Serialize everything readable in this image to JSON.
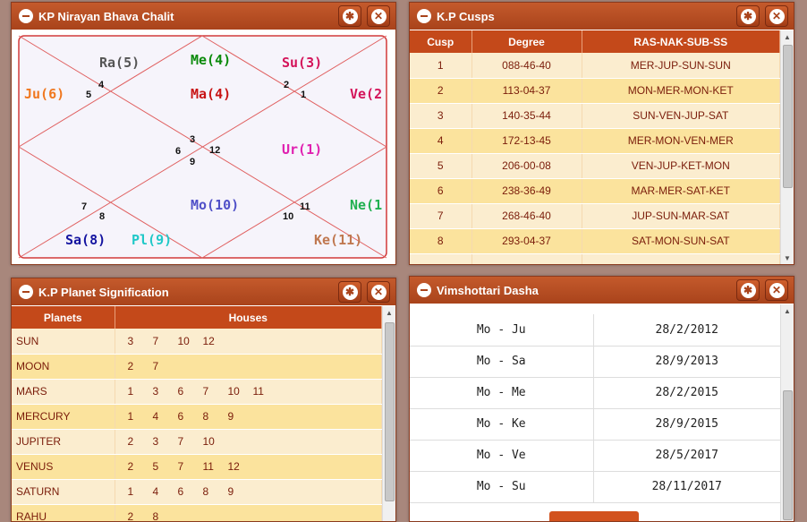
{
  "chalit": {
    "title": "KP Nirayan Bhava Chalit",
    "planets": [
      {
        "label": "Ra(5)",
        "color": "#555555"
      },
      {
        "label": "Me(4)",
        "color": "#0a8a0a"
      },
      {
        "label": "Su(3)",
        "color": "#d4145a"
      },
      {
        "label": "Ju(6)",
        "color": "#f07820"
      },
      {
        "label": "Ma(4)",
        "color": "#c81414"
      },
      {
        "label": "Ve(2",
        "color": "#d4145a"
      },
      {
        "label": "Ur(1)",
        "color": "#e020b0"
      },
      {
        "label": "Mo(10)",
        "color": "#5050c8"
      },
      {
        "label": "Ne(1",
        "color": "#20b050"
      },
      {
        "label": "Sa(8)",
        "color": "#1414a0"
      },
      {
        "label": "Pl(9)",
        "color": "#20c8c8"
      },
      {
        "label": "Ke(11)",
        "color": "#c07850"
      }
    ],
    "house_numbers": [
      "4",
      "5",
      "2",
      "1",
      "3",
      "6",
      "12",
      "9",
      "7",
      "8",
      "11",
      "10"
    ]
  },
  "cusps": {
    "title": "K.P Cusps",
    "columns": [
      "Cusp",
      "Degree",
      "RAS-NAK-SUB-SS"
    ],
    "rows": [
      [
        "1",
        "088-46-40",
        "MER-JUP-SUN-SUN"
      ],
      [
        "2",
        "113-04-37",
        "MON-MER-MON-KET"
      ],
      [
        "3",
        "140-35-44",
        "SUN-VEN-JUP-SAT"
      ],
      [
        "4",
        "172-13-45",
        "MER-MON-VEN-MER"
      ],
      [
        "5",
        "206-00-08",
        "VEN-JUP-KET-MON"
      ],
      [
        "6",
        "238-36-49",
        "MAR-MER-SAT-KET"
      ],
      [
        "7",
        "268-46-40",
        "JUP-SUN-MAR-SAT"
      ],
      [
        "8",
        "293-04-37",
        "SAT-MON-SUN-SAT"
      ]
    ]
  },
  "signification": {
    "title": "K.P Planet Signification",
    "columns": [
      "Planets",
      "Houses"
    ],
    "rows": [
      {
        "planet": "SUN",
        "houses": [
          "3",
          "7",
          "10",
          "12"
        ]
      },
      {
        "planet": "MOON",
        "houses": [
          "2",
          "7"
        ]
      },
      {
        "planet": "MARS",
        "houses": [
          "1",
          "3",
          "6",
          "7",
          "10",
          "11"
        ]
      },
      {
        "planet": "MERCURY",
        "houses": [
          "1",
          "4",
          "6",
          "8",
          "9"
        ]
      },
      {
        "planet": "JUPITER",
        "houses": [
          "2",
          "3",
          "7",
          "10"
        ]
      },
      {
        "planet": "VENUS",
        "houses": [
          "2",
          "5",
          "7",
          "11",
          "12"
        ]
      },
      {
        "planet": "SATURN",
        "houses": [
          "1",
          "4",
          "6",
          "8",
          "9"
        ]
      },
      {
        "planet": "RAHU",
        "houses": [
          "2",
          "8"
        ]
      }
    ]
  },
  "dasha": {
    "title": "Vimshottari Dasha",
    "rows": [
      [
        "Mo - Ju",
        "28/2/2012"
      ],
      [
        "Mo - Sa",
        "28/9/2013"
      ],
      [
        "Mo - Me",
        "28/2/2015"
      ],
      [
        "Mo - Ke",
        "28/9/2015"
      ],
      [
        "Mo - Ve",
        "28/5/2017"
      ],
      [
        "Mo - Su",
        "28/11/2017"
      ]
    ]
  }
}
